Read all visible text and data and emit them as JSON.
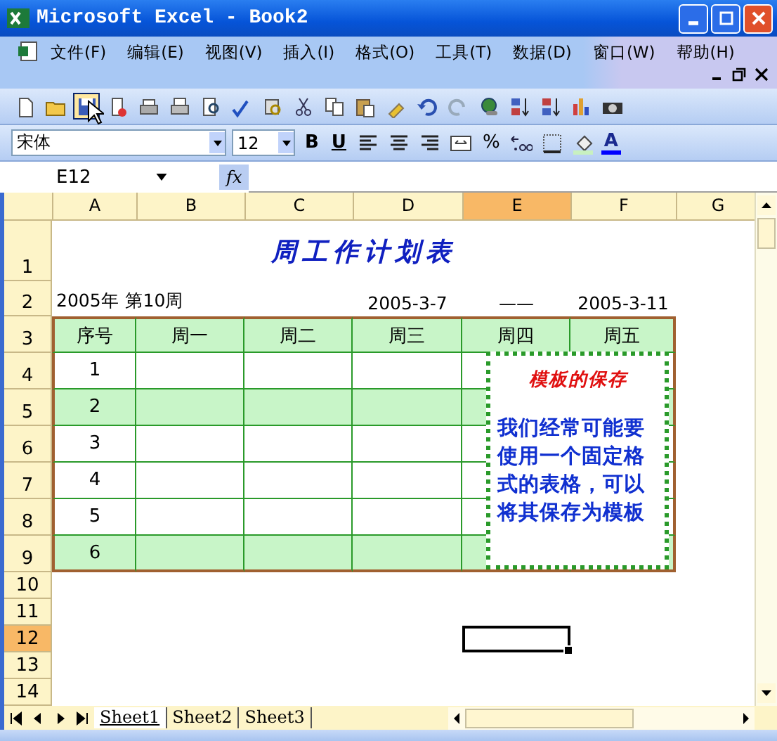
{
  "window": {
    "title": "Microsoft Excel - Book2"
  },
  "menu": [
    {
      "label": "文件(F)"
    },
    {
      "label": "编辑(E)"
    },
    {
      "label": "视图(V)"
    },
    {
      "label": "插入(I)"
    },
    {
      "label": "格式(O)"
    },
    {
      "label": "工具(T)"
    },
    {
      "label": "数据(D)"
    },
    {
      "label": "窗口(W)"
    },
    {
      "label": "帮助(H)"
    }
  ],
  "format_toolbar": {
    "font": "宋体",
    "size": "12",
    "bold": "B",
    "underline": "U",
    "percent": "%",
    "font_color": "A"
  },
  "formula_bar": {
    "name_box": "E12",
    "function_label": "fx"
  },
  "sheet": {
    "columns": [
      {
        "label": "A",
        "selected": false
      },
      {
        "label": "B",
        "selected": false
      },
      {
        "label": "C",
        "selected": false
      },
      {
        "label": "D",
        "selected": false
      },
      {
        "label": "E",
        "selected": true
      },
      {
        "label": "F",
        "selected": false
      },
      {
        "label": "G",
        "selected": false
      }
    ],
    "rows": [
      {
        "label": "1",
        "selected": false,
        "kind": "title",
        "text": "周工作计划表"
      },
      {
        "label": "2",
        "selected": false,
        "kind": "info",
        "week": "2005年  第10周",
        "start": "2005-3-7",
        "dash": "——",
        "end": "2005-3-11"
      },
      {
        "label": "3",
        "selected": false,
        "kind": "header",
        "cells": [
          "序号",
          "周一",
          "周二",
          "周三",
          "周四",
          "周五"
        ]
      },
      {
        "label": "4",
        "selected": false,
        "kind": "data",
        "number": "1",
        "shaded": false
      },
      {
        "label": "5",
        "selected": false,
        "kind": "data",
        "number": "2",
        "shaded": true
      },
      {
        "label": "6",
        "selected": false,
        "kind": "data",
        "number": "3",
        "shaded": false
      },
      {
        "label": "7",
        "selected": false,
        "kind": "data",
        "number": "4",
        "shaded": false
      },
      {
        "label": "8",
        "selected": false,
        "kind": "data",
        "number": "5",
        "shaded": false
      },
      {
        "label": "9",
        "selected": false,
        "kind": "data",
        "number": "6",
        "shaded": true
      },
      {
        "label": "10",
        "selected": false,
        "kind": "empty"
      },
      {
        "label": "11",
        "selected": false,
        "kind": "empty"
      },
      {
        "label": "12",
        "selected": true,
        "kind": "empty"
      },
      {
        "label": "13",
        "selected": false,
        "kind": "empty"
      },
      {
        "label": "14",
        "selected": false,
        "kind": "empty"
      }
    ]
  },
  "text_box": {
    "heading": "模板的保存",
    "body": "我们经常可能要使用一个固定格式的表格，可以将其保存为模板"
  },
  "sheet_tabs": [
    {
      "label": "Sheet1",
      "selected": true
    },
    {
      "label": "Sheet2",
      "selected": false
    },
    {
      "label": "Sheet3",
      "selected": false
    }
  ]
}
